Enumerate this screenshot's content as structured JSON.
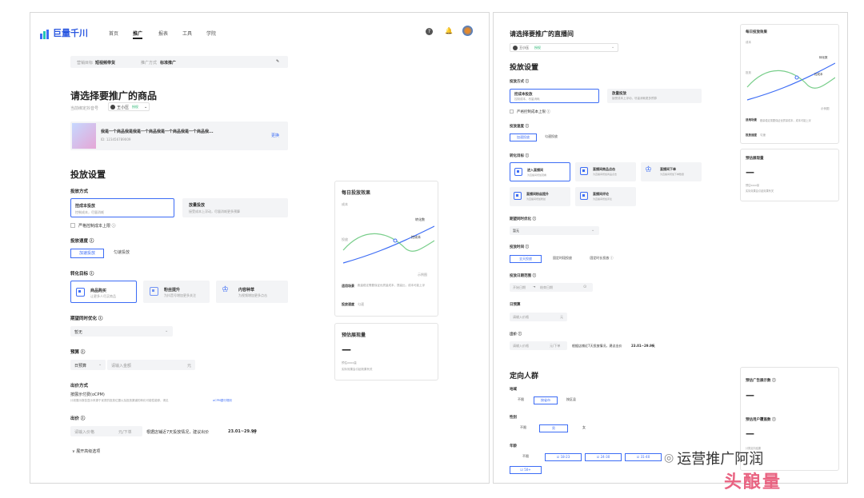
{
  "left": {
    "brand": "巨量千川",
    "nav": [
      "首页",
      "推广",
      "报表",
      "工具",
      "学院"
    ],
    "summary": {
      "goal_label": "营销目标",
      "goal_value": "短视频带货",
      "mode_label": "推广方式",
      "mode_value": "标准推广"
    },
    "product_title": "请选择要推广的商品",
    "account_label": "当前绑定抖音号",
    "account_name": "王小压",
    "account_badge": "授权",
    "product_name": "我是一个商品我是我是一个商品我是一个商品我是一个商品我...",
    "product_id": "ID: 123456789009",
    "change": "更换",
    "settings_title": "投放设置",
    "method_label": "投放方式",
    "method_a_title": "控成本投放",
    "method_a_desc": "控制成本，尽量消耗",
    "method_b_title": "放量投放",
    "method_b_desc": "接受成本上浮动，尽量消耗更多预算",
    "strict_cost": "严格控制成本上限 ⓘ",
    "speed_label": "投放速度 ⓘ",
    "speed_opts": [
      "加速投放",
      "匀速投放"
    ],
    "conv_label": "转化目标 ⓘ",
    "conv_opts": [
      {
        "title": "商品购买",
        "desc": "让更多人尽买商品"
      },
      {
        "title": "粉丝提升",
        "desc": "为抖音号增加更多关注"
      },
      {
        "title": "内容种草",
        "desc": "为视频增加更多点击"
      }
    ],
    "opt_label": "期望同时优化 ⓘ",
    "opt_value": "暂无",
    "budget_label": "预算 ⓘ",
    "budget_type": "日预算",
    "budget_ph": "请输入金额",
    "budget_unit": "元",
    "bid_method_label": "出价方式",
    "bid_method_value": "按展示付费(oCPM)",
    "bid_method_desc": "计划展示报告显示来源于优质的投放位置以及投放渠道的转化可能性能够，请见",
    "bid_link": "oCPM银行规则",
    "bid_label": "出价 ⓘ",
    "bid_ph": "请输入价格",
    "bid_unit": "元/下单",
    "bid_hint": "根据店铺近7天投放情况，建议出价",
    "bid_range": "23.01~29.99",
    "bid_yuan": "元",
    "expand": "∨ 展开高级选项",
    "effect_title": "每日投放效果",
    "effect_cost": "成本",
    "effect_conv": "转化数",
    "effect_ctrl": "控成本",
    "effect_budget": "投放",
    "effect_foot": "示例图",
    "scene_label": "适用场景",
    "scene_desc": "跑量稳定需要保证优质量成本，提高比，成本可能上浮",
    "speed_info_label": "投放速度",
    "speed_info_value": "匀速",
    "est_title": "预估展现量",
    "est_dash": "—",
    "est_line1": "预估xxxx量",
    "est_line2": "实际效果会引起效果有关"
  },
  "right": {
    "live_title": "请选择要推广的直播间",
    "live_name": "王小压",
    "live_badge": "授权",
    "settings_title": "投放设置",
    "method_label": "投放方式 ⓘ",
    "method_a_title": "控成本投放",
    "method_a_desc": "控制成本，尽量消耗",
    "method_b_title": "放量投放",
    "method_b_desc": "接受成本上浮动，尽量消耗更多预算",
    "strict_cost": "严格控制成本上限 ⓘ",
    "speed_label": "投放速度 ⓘ",
    "speed_opts": [
      "加速投放",
      "匀速投放"
    ],
    "conv_label": "转化目标 ⓘ",
    "conv_opts": [
      {
        "title": "进入直播间",
        "desc": "为直播间增加观看"
      },
      {
        "title": "直播间商品点击",
        "desc": "为直播间增加商品点击"
      },
      {
        "title": "直播间下单",
        "desc": "为直播间增加下单数量"
      },
      {
        "title": "直播间粉丝提升",
        "desc": "为直播间增加粉丝"
      },
      {
        "title": "直播间评论",
        "desc": "为直播间增加评论"
      }
    ],
    "opt_label": "期望同时优化 ⓘ",
    "opt_value": "暂无",
    "time_label": "投放时间 ⓘ",
    "time_opts": [
      "全天投放",
      "固定时段投放",
      "固定时长投放 ⓘ"
    ],
    "date_label": "投放日期范围 ⓘ",
    "date_start": "开始日期",
    "date_arrow": "→",
    "date_end": "结束日期",
    "budget_label": "日预算",
    "budget_ph": "请输入价格",
    "budget_unit": "元",
    "bid_label": "出价 ⓘ",
    "bid_ph": "请输入价格",
    "bid_unit": "元/下单",
    "bid_hint": "根据店铺近7天投放情况，建议出价",
    "bid_range": "23.01~29.99",
    "bid_yuan": "元",
    "target_title": "定向人群",
    "region_label": "地域",
    "region_opts": [
      "不限",
      "按省市",
      "按区县"
    ],
    "gender_label": "性别",
    "gender_opts": [
      "不限",
      "男",
      "女"
    ],
    "age_label": "年龄",
    "age_opts": [
      "不限",
      "18-23",
      "24-30",
      "31-40",
      "50+"
    ],
    "effect_title": "每日投放效果",
    "effect_cost": "成本",
    "effect_conv": "转化数",
    "effect_ctrl": "控成本",
    "effect_budget": "投放",
    "effect_foot": "示例图",
    "scene_label": "适用场景",
    "scene_desc": "跑量稳定需要保证优质量成本，成本可能上浮",
    "speed_info_label": "投放速度",
    "speed_info_value": "匀速",
    "est_title": "预估展现量",
    "est_dash": "—",
    "est_line1": "预估xxxx量",
    "est_line2": "实际效果会引起效果有关",
    "ad_title": "预估广告展示数 ⓘ",
    "ad_dash": "—",
    "user_title": "预估用户覆盖数 ⓘ",
    "user_dash": "—",
    "user_line": "计算定向结果"
  },
  "watermark": "运营推广阿润",
  "watermark2": "头酿量"
}
